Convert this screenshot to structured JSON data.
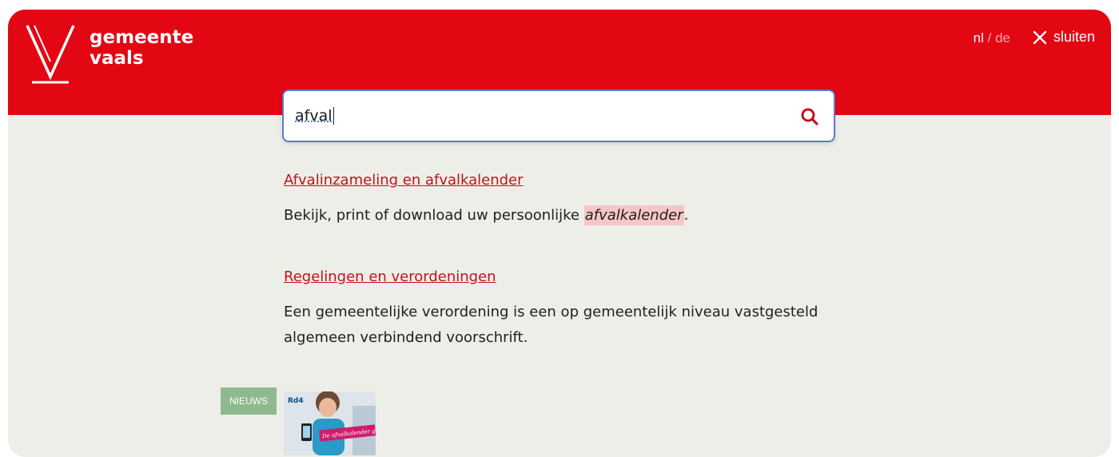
{
  "header": {
    "brand_line1": "gemeente",
    "brand_line2": "vaals",
    "lang_current": "nl",
    "lang_separator": "/",
    "lang_other": "de",
    "close_label": "sluiten"
  },
  "search": {
    "value": "afval"
  },
  "results": [
    {
      "title": "Afvalinzameling en afvalkalender",
      "desc_before": "Bekijk, print of download uw persoonlijke ",
      "desc_highlight": "afvalkalender",
      "desc_after": "."
    },
    {
      "title": "Regelingen en verordeningen",
      "description": "Een gemeentelijke verordening is een op gemeentelijk niveau vastgesteld algemeen verbindend voorschrift."
    }
  ],
  "news": {
    "badge": "NIEUWS",
    "thumb_brand": "Rd4",
    "thumb_banner": "De afvalkalender gaat digitaal"
  },
  "colors": {
    "brand_red": "#e30613",
    "background": "#eeeee9",
    "link_red": "#c4121b",
    "highlight": "#f7c6c6",
    "badge_green": "#8fb98e"
  },
  "icons": [
    "vaals-v-logo",
    "close-icon",
    "search-icon"
  ]
}
